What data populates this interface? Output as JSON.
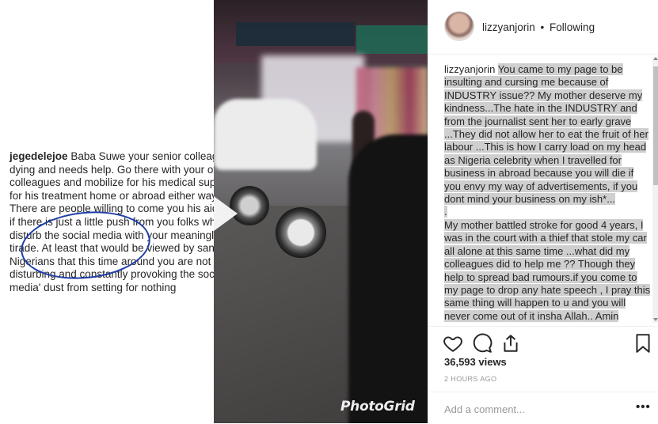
{
  "left_comment": {
    "username": "jegedelejoe",
    "text": "Baba Suwe your senior colleague is dying and needs help. Go there with your other colleagues and mobilize for his medical support for his treatment home or abroad either way. There are people willing to come you his aid only if there is just a little push from you folks who disturb the social media with your meaningless tirade. At least that would be viewed by sane Nigerians that this time around you are not just disturbing and constantly provoking the social media' dust from setting for nothing"
  },
  "video": {
    "watermark": "PhotoGrid",
    "play_icon": "play-icon"
  },
  "header": {
    "username": "lizzyanjorin",
    "separator": "•",
    "follow_status": "Following"
  },
  "caption": {
    "username": "lizzyanjorin",
    "paragraph1": "You came to my page to be insulting and cursing me because of INDUSTRY issue?? My mother deserve my kindness...The hate in the INDUSTRY and from the journalist sent her to early grave ...They did not allow her to eat the fruit of her labour ...This is how I carry load on my head as Nigeria celebrity when I travelled for business in abroad because you will die if you envy my way of advertisements, if you dont mind your business on my ish*...",
    "paragraph1_end": ".",
    "paragraph2": "My mother battled stroke for good 4 years, I was in the court with a thief that stole my car all alone at this same time ...what did my colleagues did to help me ?? Though they help to spread bad rumours.if you come to my page to drop any hate speech , I pray this same thing will happen to u and you will never come out of it insha Allah.. Amin"
  },
  "actions": {
    "like_icon": "heart-icon",
    "comment_icon": "comment-icon",
    "share_icon": "share-icon",
    "save_icon": "bookmark-icon"
  },
  "stats": {
    "views": "36,593 views",
    "time": "2 HOURS AGO"
  },
  "comment_box": {
    "placeholder": "Add a comment...",
    "more": "•••"
  }
}
